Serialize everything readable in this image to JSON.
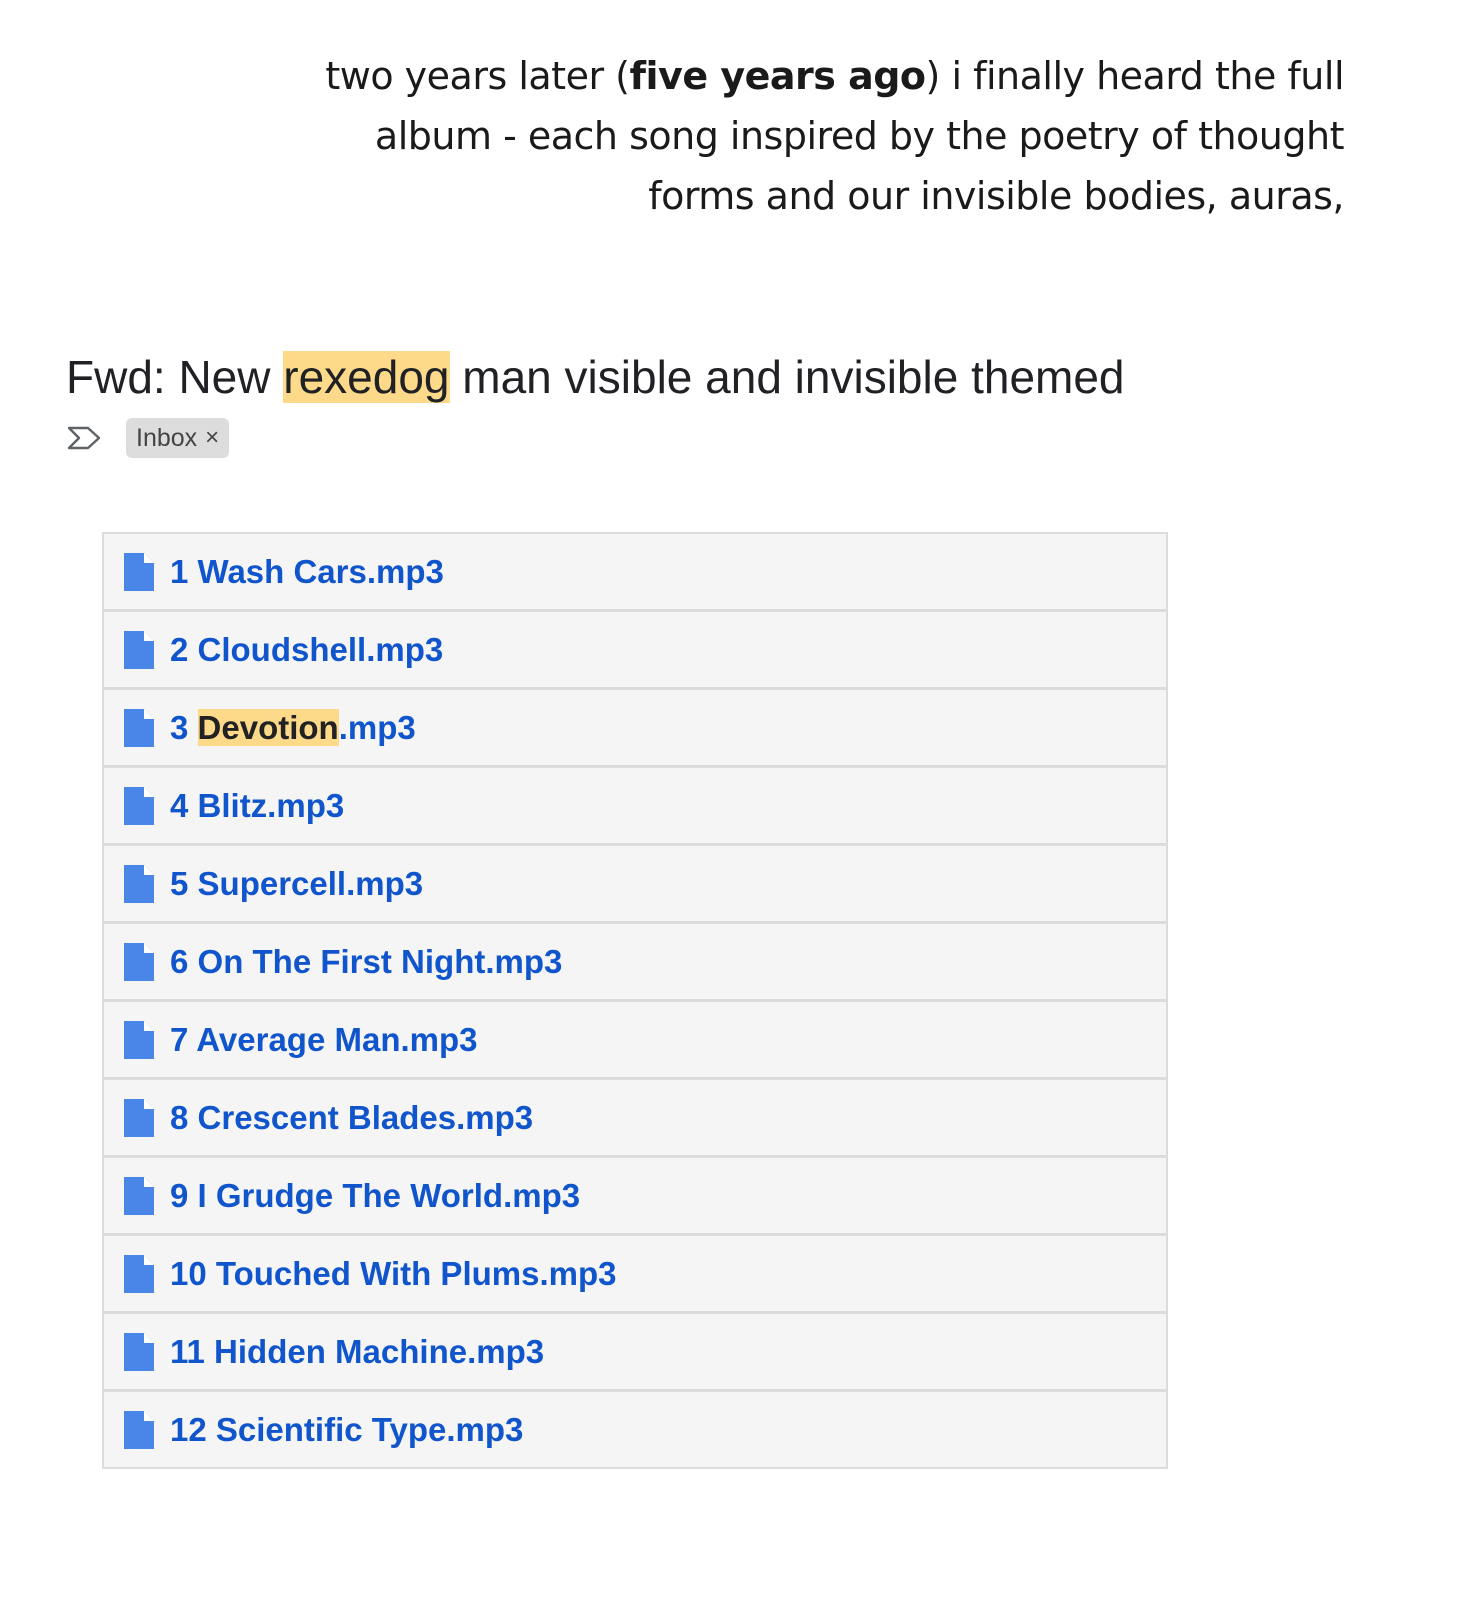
{
  "caption": {
    "line1_pre": "two years later (",
    "line1_bold": "five years ago",
    "line1_post": ") i finally heard the full",
    "line2": "album - each song inspired by the poetry of thought",
    "line3": "forms and our invisible bodies, auras,"
  },
  "email": {
    "subject_prefix": "Fwd: New ",
    "subject_highlight": "rexedog",
    "subject_suffix": " man visible and invisible themed",
    "label": "Inbox",
    "label_remove": "×",
    "highlight_color": "#fdd98a",
    "link_color": "#1155cc"
  },
  "attachments": [
    {
      "name": "1 Wash Cars.mp3"
    },
    {
      "name": "2 Cloudshell.mp3"
    },
    {
      "pre": "3 ",
      "highlight": "Devotion",
      "post": ".mp3"
    },
    {
      "name": "4 Blitz.mp3"
    },
    {
      "name": "5 Supercell.mp3"
    },
    {
      "name": "6 On The First Night.mp3"
    },
    {
      "name": "7 Average Man.mp3"
    },
    {
      "name": "8 Crescent Blades.mp3"
    },
    {
      "name": "9 I Grudge The World.mp3"
    },
    {
      "name": "10 Touched With Plums.mp3"
    },
    {
      "name": "11 Hidden Machine.mp3"
    },
    {
      "name": "12 Scientific Type.mp3"
    }
  ]
}
